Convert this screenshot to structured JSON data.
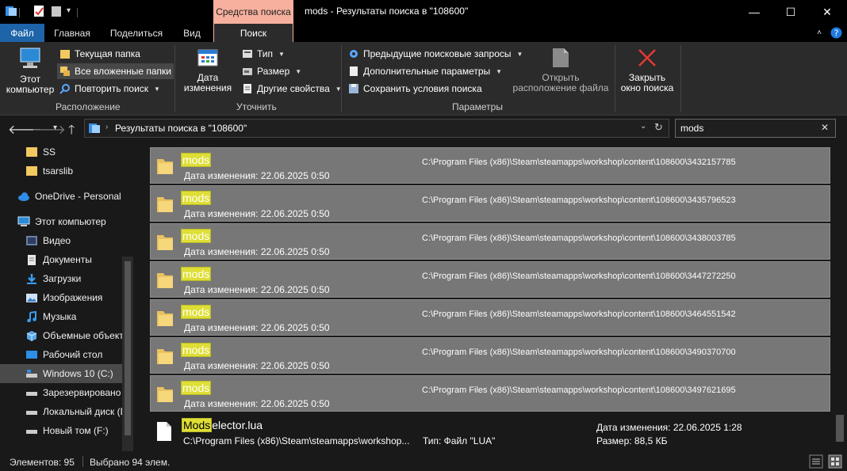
{
  "titlebar": {
    "context_tab": "Средства поиска",
    "title": "mods - Результаты поиска в \"108600\"",
    "minimize": "—",
    "maximize": "☐",
    "close": "✕"
  },
  "tabs": {
    "file": "Файл",
    "home": "Главная",
    "share": "Поделиться",
    "view": "Вид",
    "search": "Поиск"
  },
  "ribbon": {
    "this_pc_line1": "Этот",
    "this_pc_line2": "компьютер",
    "current_folder": "Текущая папка",
    "all_subfolders": "Все вложенные папки",
    "repeat_search": "Повторить поиск",
    "group_location": "Расположение",
    "date_modified_line1": "Дата",
    "date_modified_line2": "изменения",
    "kind": "Тип",
    "size": "Размер",
    "other_properties": "Другие свойства",
    "group_refine": "Уточнить",
    "recent_searches": "Предыдущие поисковые запросы",
    "advanced_options": "Дополнительные параметры",
    "save_search": "Сохранить условия поиска",
    "open_location_line1": "Открыть",
    "open_location_line2": "расположение файла",
    "close_search_line1": "Закрыть",
    "close_search_line2": "окно поиска",
    "group_options": "Параметры"
  },
  "address": {
    "path": "Результаты поиска в \"108600\"",
    "search_value": "mods"
  },
  "sidebar": {
    "items": [
      {
        "label": "SS"
      },
      {
        "label": "tsarslib"
      },
      {
        "label": "OneDrive - Personal"
      },
      {
        "label": "Этот компьютер"
      },
      {
        "label": "Видео"
      },
      {
        "label": "Документы"
      },
      {
        "label": "Загрузки"
      },
      {
        "label": "Изображения"
      },
      {
        "label": "Музыка"
      },
      {
        "label": "Объемные объекты"
      },
      {
        "label": "Рабочий стол"
      },
      {
        "label": "Windows 10 (C:)"
      },
      {
        "label": "Зарезервировано"
      },
      {
        "label": "Локальный диск (D:)"
      },
      {
        "label": "Новый том (F:)"
      }
    ]
  },
  "results": {
    "rows": [
      {
        "name": "mods",
        "date": "Дата изменения: 22.06.2025 0:50",
        "path": "C:\\Program Files (x86)\\Steam\\steamapps\\workshop\\content\\108600\\3432157785"
      },
      {
        "name": "mods",
        "date": "Дата изменения: 22.06.2025 0:50",
        "path": "C:\\Program Files (x86)\\Steam\\steamapps\\workshop\\content\\108600\\3435796523"
      },
      {
        "name": "mods",
        "date": "Дата изменения: 22.06.2025 0:50",
        "path": "C:\\Program Files (x86)\\Steam\\steamapps\\workshop\\content\\108600\\3438003785"
      },
      {
        "name": "mods",
        "date": "Дата изменения: 22.06.2025 0:50",
        "path": "C:\\Program Files (x86)\\Steam\\steamapps\\workshop\\content\\108600\\3447272250"
      },
      {
        "name": "mods",
        "date": "Дата изменения: 22.06.2025 0:50",
        "path": "C:\\Program Files (x86)\\Steam\\steamapps\\workshop\\content\\108600\\3464551542"
      },
      {
        "name": "mods",
        "date": "Дата изменения: 22.06.2025 0:50",
        "path": "C:\\Program Files (x86)\\Steam\\steamapps\\workshop\\content\\108600\\3490370700"
      },
      {
        "name": "mods",
        "date": "Дата изменения: 22.06.2025 0:50",
        "path": "C:\\Program Files (x86)\\Steam\\steamapps\\workshop\\content\\108600\\3497621695"
      }
    ],
    "file": {
      "name_highlight": "Mods",
      "name_rest": "elector.lua",
      "path": "C:\\Program Files (x86)\\Steam\\steamapps\\workshop...",
      "type": "Тип: Файл \"LUA\"",
      "modified": "Дата изменения: 22.06.2025 1:28",
      "size": "Размер: 88,5 КБ"
    }
  },
  "status": {
    "items_count": "Элементов: 95",
    "selected_count": "Выбрано 94 элем."
  },
  "colors": {
    "highlight": "#dede36",
    "selected_row": "#777777",
    "context_tab": "#f6b09d",
    "file_tab": "#1d64a8"
  }
}
